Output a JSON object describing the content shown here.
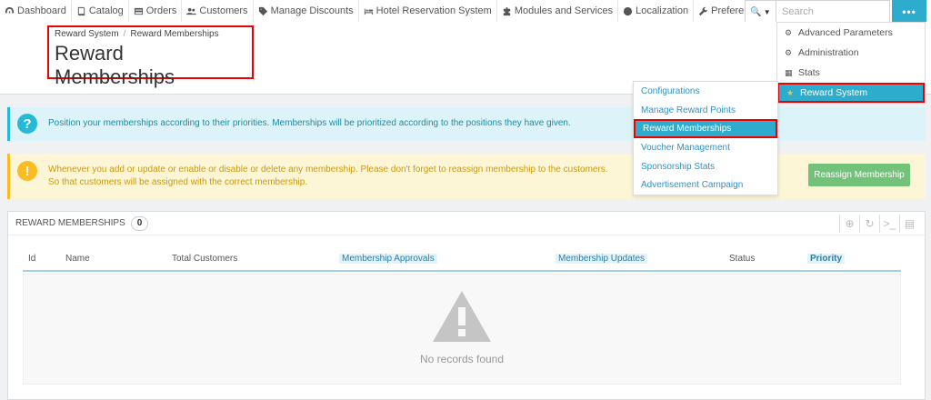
{
  "nav": {
    "items": [
      {
        "label": "Dashboard",
        "icon": "dashboard-icon"
      },
      {
        "label": "Catalog",
        "icon": "book-icon"
      },
      {
        "label": "Orders",
        "icon": "credit-card-icon"
      },
      {
        "label": "Customers",
        "icon": "users-icon"
      },
      {
        "label": "Manage Discounts",
        "icon": "tag-icon"
      },
      {
        "label": "Hotel Reservation System",
        "icon": "bed-icon"
      },
      {
        "label": "Modules and Services",
        "icon": "puzzle-icon"
      },
      {
        "label": "Localization",
        "icon": "globe-icon"
      },
      {
        "label": "Preferences",
        "icon": "wrench-icon"
      }
    ]
  },
  "search": {
    "placeholder": "Search"
  },
  "header": {
    "breadcrumb_parent": "Reward System",
    "breadcrumb_sep": "/",
    "breadcrumb_current": "Reward Memberships",
    "title": "Reward Memberships"
  },
  "alerts": {
    "info": "Position your memberships according to their priorities. Memberships will be prioritized according to the positions they have given.",
    "warning": "Whenever you add or update or enable or disable or delete any membership. Please don't forget to reassign membership to the customers. So that customers will be assigned with the correct membership.",
    "reassign_label": "Reassign Membership"
  },
  "panel": {
    "title": "REWARD MEMBERSHIPS",
    "count": "0",
    "columns": {
      "id": "Id",
      "name": "Name",
      "total_customers": "Total Customers",
      "approvals": "Membership Approvals",
      "updates": "Membership Updates",
      "status": "Status",
      "priority": "Priority"
    },
    "empty_text": "No records found"
  },
  "admin_menu": {
    "items": [
      {
        "label": "Advanced Parameters",
        "icon": "cogs-icon"
      },
      {
        "label": "Administration",
        "icon": "cog-icon"
      },
      {
        "label": "Stats",
        "icon": "bar-chart-icon"
      },
      {
        "label": "Reward System",
        "icon": "trophy-icon"
      }
    ]
  },
  "submenu": {
    "items": [
      "Configurations",
      "Manage Reward Points",
      "Reward Memberships",
      "Voucher Management",
      "Sponsorship Stats",
      "Advertisement Campaign"
    ]
  },
  "colors": {
    "accent": "#2eacce",
    "highlight_border": "#e00000",
    "success": "#72c279",
    "warning": "#fbbb22",
    "info": "#25b9d7"
  }
}
